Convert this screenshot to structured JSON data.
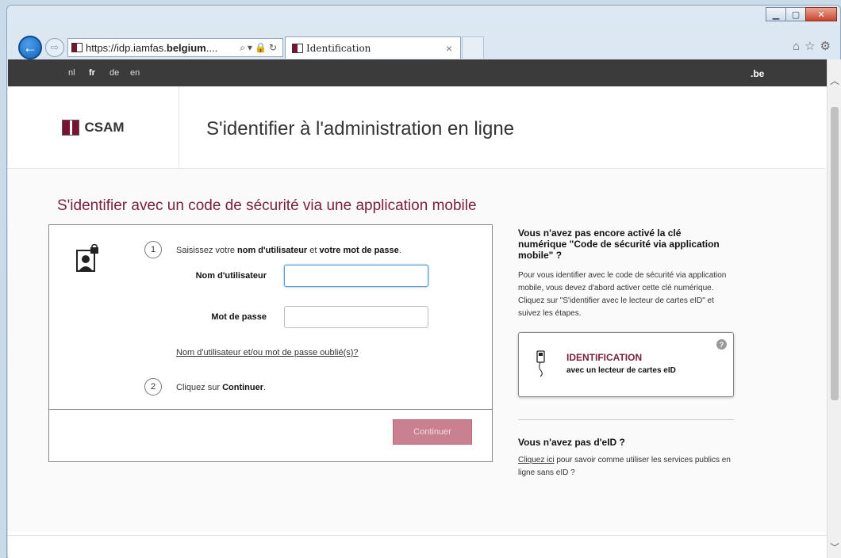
{
  "browser": {
    "url_prefix": "https://idp.iamfas.",
    "url_bold": "belgium",
    "url_suffix": "....",
    "tab_title": "Identification",
    "tab_close": "×"
  },
  "lang_bar": {
    "langs": [
      "nl",
      "fr",
      "de",
      "en"
    ],
    "active": "fr",
    "domain_suffix": ".be"
  },
  "header": {
    "logo_text": "CSAM",
    "title": "S'identifier à l'administration en ligne"
  },
  "main": {
    "section_title": "S'identifier avec un code de sécurité via une application mobile",
    "step1": {
      "number": "1",
      "text_prefix": "Saisissez votre ",
      "text_bold1": "nom d'utilisateur",
      "text_mid": " et ",
      "text_bold2": "votre mot de passe",
      "text_suffix": "."
    },
    "username_label": "Nom d'utilisateur",
    "username_value": "",
    "password_label": "Mot de passe",
    "password_value": "",
    "forgot_link": "Nom d'utilisateur et/ou mot de passe oublié(s)?",
    "step2": {
      "number": "2",
      "text_prefix": "Cliquez sur ",
      "text_bold": "Continuer",
      "text_suffix": "."
    },
    "continue_label": "Continuer"
  },
  "side": {
    "heading": "Vous n'avez pas encore activé la clé numérique \"Code de sécurité via application mobile\" ?",
    "text": "Pour vous identifier avec le code de sécurité via application mobile, vous devez d'abord activer cette clé numérique. Cliquez sur \"S'identifier avec le lecteur de cartes eID\" et suivez les étapes.",
    "eid_title": "IDENTIFICATION",
    "eid_sub": "avec un lecteur de cartes eID",
    "help": "?",
    "no_eid_heading": "Vous n'avez pas d'eID ?",
    "no_eid_link": "Cliquez ici",
    "no_eid_text": " pour savoir comme utiliser les services publics en ligne sans eID ?"
  }
}
